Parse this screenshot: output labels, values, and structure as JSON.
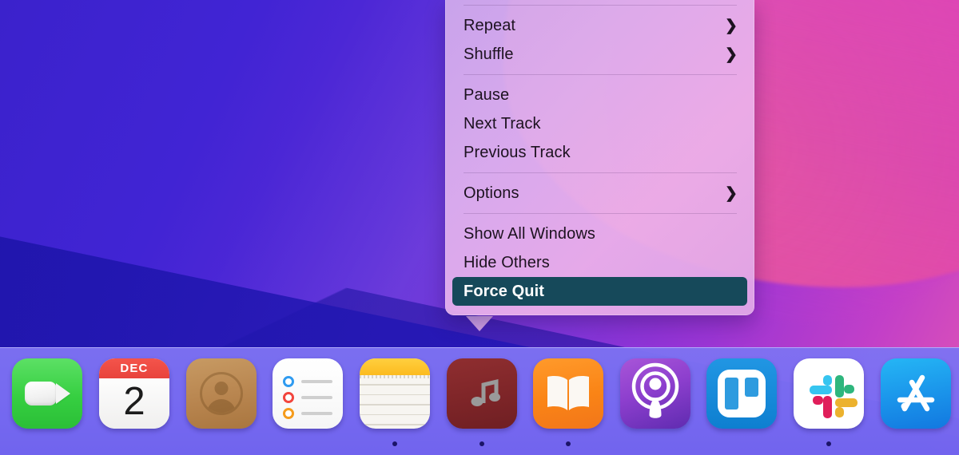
{
  "wallpaper": {
    "name": "monterey-gradient",
    "colors": [
      "#3b22cc",
      "#7b31d8",
      "#e055b4",
      "#1b14a6"
    ]
  },
  "context_menu": {
    "name": "music-dock-context-menu",
    "accent_selected_bg": "#16495a",
    "accent_selected_fg": "#ffffff",
    "groups": [
      {
        "items": [
          {
            "label": "Repeat",
            "submenu": true,
            "selected": false
          },
          {
            "label": "Shuffle",
            "submenu": true,
            "selected": false
          }
        ]
      },
      {
        "items": [
          {
            "label": "Pause",
            "submenu": false,
            "selected": false
          },
          {
            "label": "Next Track",
            "submenu": false,
            "selected": false
          },
          {
            "label": "Previous Track",
            "submenu": false,
            "selected": false
          }
        ]
      },
      {
        "items": [
          {
            "label": "Options",
            "submenu": true,
            "selected": false
          }
        ]
      },
      {
        "items": [
          {
            "label": "Show All Windows",
            "submenu": false,
            "selected": false
          },
          {
            "label": "Hide Others",
            "submenu": false,
            "selected": false
          },
          {
            "label": "Force Quit",
            "submenu": false,
            "selected": true
          }
        ]
      }
    ],
    "submenu_glyph": "❯"
  },
  "dock": {
    "name": "macos-dock",
    "background": "#7a6cf2",
    "running_indicator_color": "#1b1468",
    "items": [
      {
        "name": "facetime",
        "label": "FaceTime",
        "icon": "facetime-icon",
        "running": false,
        "active": false
      },
      {
        "name": "calendar",
        "label": "Calendar",
        "icon": "calendar-icon",
        "running": false,
        "active": false,
        "month": "DEC",
        "day": "2"
      },
      {
        "name": "contacts",
        "label": "Contacts",
        "icon": "contacts-icon",
        "running": false,
        "active": false
      },
      {
        "name": "reminders",
        "label": "Reminders",
        "icon": "reminders-icon",
        "running": false,
        "active": false,
        "dot_colors": [
          "#2f9bf0",
          "#f2453d",
          "#f59b1b"
        ]
      },
      {
        "name": "notes",
        "label": "Notes",
        "icon": "notes-icon",
        "running": true,
        "active": false
      },
      {
        "name": "music",
        "label": "Music",
        "icon": "music-icon",
        "running": true,
        "active": true
      },
      {
        "name": "books",
        "label": "Books",
        "icon": "books-icon",
        "running": true,
        "active": false
      },
      {
        "name": "podcasts",
        "label": "Podcasts",
        "icon": "podcasts-icon",
        "running": false,
        "active": false
      },
      {
        "name": "trello",
        "label": "Trello",
        "icon": "trello-icon",
        "running": false,
        "active": false
      },
      {
        "name": "slack",
        "label": "Slack",
        "icon": "slack-icon",
        "running": true,
        "active": false,
        "petal_colors": [
          "#36c5f0",
          "#2eb67d",
          "#ecb22e",
          "#e01e5a"
        ]
      },
      {
        "name": "app-store",
        "label": "App Store",
        "icon": "app-store-icon",
        "running": false,
        "active": false
      }
    ]
  }
}
